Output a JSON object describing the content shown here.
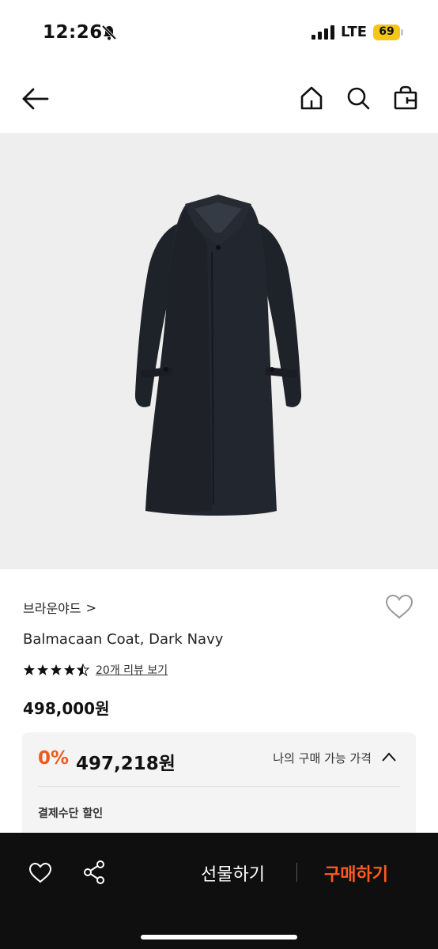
{
  "status_bar": {
    "time": "12:26",
    "network": "LTE",
    "battery": "69",
    "battery_color": "#f5c518"
  },
  "nav": {
    "icons": [
      "back-arrow-icon",
      "home-icon",
      "search-icon",
      "shopping-bag-icon"
    ]
  },
  "product": {
    "image": "dark navy balmacaan coat",
    "brand": "브라운야드",
    "brand_chevron": ">",
    "name": "Balmacaan Coat, Dark Navy",
    "rating_stars": 4.5,
    "review_link": "20개 리뷰 보기",
    "price": "498,000원"
  },
  "discount_panel": {
    "discount_rate": "0%",
    "my_price": "497,218원",
    "label": "나의 구매 가능 가격",
    "section_title": "결제수단 할인"
  },
  "bottom_bar": {
    "gift_label": "선물하기",
    "buy_label": "구매하기",
    "accent_color": "#ff5a1f"
  }
}
